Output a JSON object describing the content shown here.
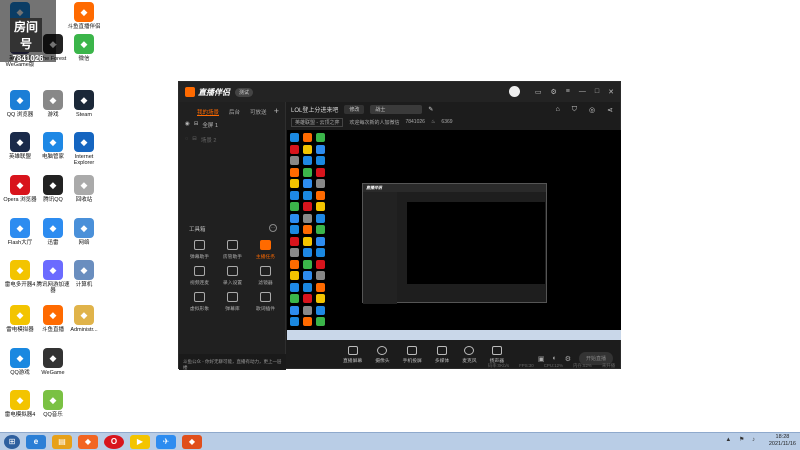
{
  "desktop": {
    "room_badge": {
      "title": "房间号",
      "number": "7841026"
    },
    "icons": [
      {
        "label": "QQ游戏",
        "name": "qq-game-icon"
      },
      {
        "label": "斗鱼直播伴侣",
        "name": "douyu-assistant-icon"
      },
      {
        "label": "英雄联盟 WeGame版",
        "name": "lol-wegame-icon"
      },
      {
        "label": "The Forest",
        "name": "the-forest-icon"
      },
      {
        "label": "微信",
        "name": "wechat-icon"
      },
      {
        "label": "QQ 浏览器",
        "name": "qq-browser-icon"
      },
      {
        "label": "游戏",
        "name": "games-folder-icon"
      },
      {
        "label": "Steam",
        "name": "steam-icon"
      },
      {
        "label": "英雄联盟",
        "name": "lol-icon"
      },
      {
        "label": "电脑管家",
        "name": "pc-manager-icon"
      },
      {
        "label": "Internet Explorer",
        "name": "ie-icon"
      },
      {
        "label": "Opera 浏览器",
        "name": "opera-icon"
      },
      {
        "label": "腾讯QQ",
        "name": "tencent-qq-icon"
      },
      {
        "label": "回收站",
        "name": "recycle-bin-icon"
      },
      {
        "label": "Flash大厅",
        "name": "flash-hall-icon"
      },
      {
        "label": "迅雷",
        "name": "xunlei-icon"
      },
      {
        "label": "网络",
        "name": "network-icon"
      },
      {
        "label": "雷电多开器4",
        "name": "ldmultiplayer-icon"
      },
      {
        "label": "腾讯网游加速器",
        "name": "tencent-accelerator-icon"
      },
      {
        "label": "计算机",
        "name": "computer-icon"
      },
      {
        "label": "雷电模拟器",
        "name": "ldplayer-icon"
      },
      {
        "label": "斗鱼直播",
        "name": "douyu-live-icon"
      },
      {
        "label": "Administr...",
        "name": "admin-folder-icon"
      },
      {
        "label": "QQ游戏",
        "name": "qq-game-2-icon"
      },
      {
        "label": "WeGame",
        "name": "wegame-icon"
      },
      {
        "label": "雷电模拟器4",
        "name": "ldplayer4-icon"
      },
      {
        "label": "QQ音乐",
        "name": "qq-music-icon"
      }
    ]
  },
  "app": {
    "title": "直播伴侣",
    "version_badge": "测试",
    "left": {
      "tabs": [
        "我的场景",
        "后台",
        "可放送"
      ],
      "scene_1": "全屏 1",
      "scene_2": "场景 2",
      "tools_title": "工具箱",
      "tools": [
        {
          "label": "弹幕助手",
          "orange": false
        },
        {
          "label": "房管助手",
          "orange": false
        },
        {
          "label": "主播任务",
          "orange": true
        },
        {
          "label": "视频连麦",
          "orange": false
        },
        {
          "label": "录入设置",
          "orange": false
        },
        {
          "label": "滤镜器",
          "orange": false
        },
        {
          "label": "虚拟形象",
          "orange": false
        },
        {
          "label": "弹幕库",
          "orange": false
        },
        {
          "label": "歌词插件",
          "orange": false
        }
      ],
      "notice": "斗鱼公众 - 你好无聊可能，直播有动力，更上一层楼"
    },
    "room": {
      "title": "LOL登上分进来吧",
      "edit_label": "修改",
      "category": "战士",
      "game_tag": "英雄联盟 - 云顶之弈",
      "welcome": "欢迎每次新的人加微信",
      "room_number": "7841026",
      "hot": "6369"
    },
    "toolbar": [
      {
        "label": "直播屏幕",
        "round": false
      },
      {
        "label": "摄像头",
        "round": true
      },
      {
        "label": "手机投屏",
        "round": false
      },
      {
        "label": "多媒体",
        "round": false
      },
      {
        "label": "麦克风",
        "round": true
      },
      {
        "label": "扬声器",
        "round": false
      }
    ],
    "go_live": "开始直播",
    "status": [
      "码率:0Kb/s",
      "FPS:30",
      "CPU:12%",
      "内存:52%",
      "未开播"
    ]
  },
  "taskbar": {
    "time": "18:28",
    "date": "2021/11/16"
  }
}
